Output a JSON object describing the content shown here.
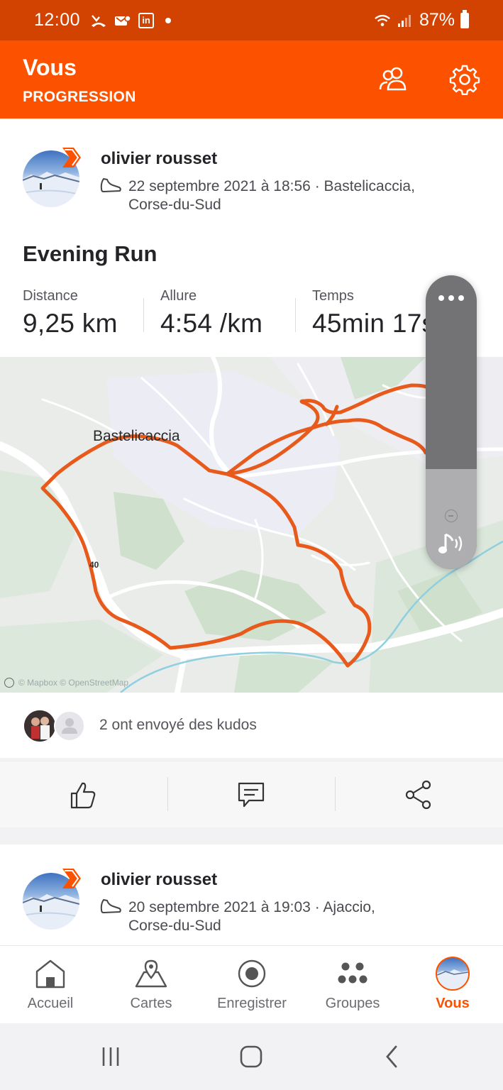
{
  "status_bar": {
    "time": "12:00",
    "battery": "87%"
  },
  "header": {
    "title": "Vous",
    "subtitle": "PROGRESSION"
  },
  "activities": [
    {
      "athlete": "olivier rousset",
      "meta_line1": "22 septembre 2021 à 18:56 · Bastelicaccia,",
      "meta_line2": "Corse-du-Sud",
      "title": "Evening Run",
      "stats": [
        {
          "label": "Distance",
          "value": "9,25 km"
        },
        {
          "label": "Allure",
          "value": "4:54 /km"
        },
        {
          "label": "Temps",
          "value": "45min 17s"
        }
      ],
      "map": {
        "place_label": "Bastelicaccia",
        "road_label": "40",
        "attribution": "© Mapbox © OpenStreetMap"
      },
      "kudos_text": "2 ont envoyé des kudos"
    },
    {
      "athlete": "olivier rousset",
      "meta_line1": "20 septembre 2021 à 19:03 · Ajaccio,",
      "meta_line2": "Corse-du-Sud"
    }
  ],
  "volume_panel": {
    "level": 0.34
  },
  "bottom_nav": [
    {
      "label": "Accueil",
      "icon": "home-icon"
    },
    {
      "label": "Cartes",
      "icon": "map-pin-icon"
    },
    {
      "label": "Enregistrer",
      "icon": "record-icon"
    },
    {
      "label": "Groupes",
      "icon": "groups-icon"
    },
    {
      "label": "Vous",
      "icon": "avatar",
      "active": true
    }
  ],
  "colors": {
    "brand": "#fc5200",
    "status_bar": "#d24200",
    "route": "#e85a1b"
  }
}
